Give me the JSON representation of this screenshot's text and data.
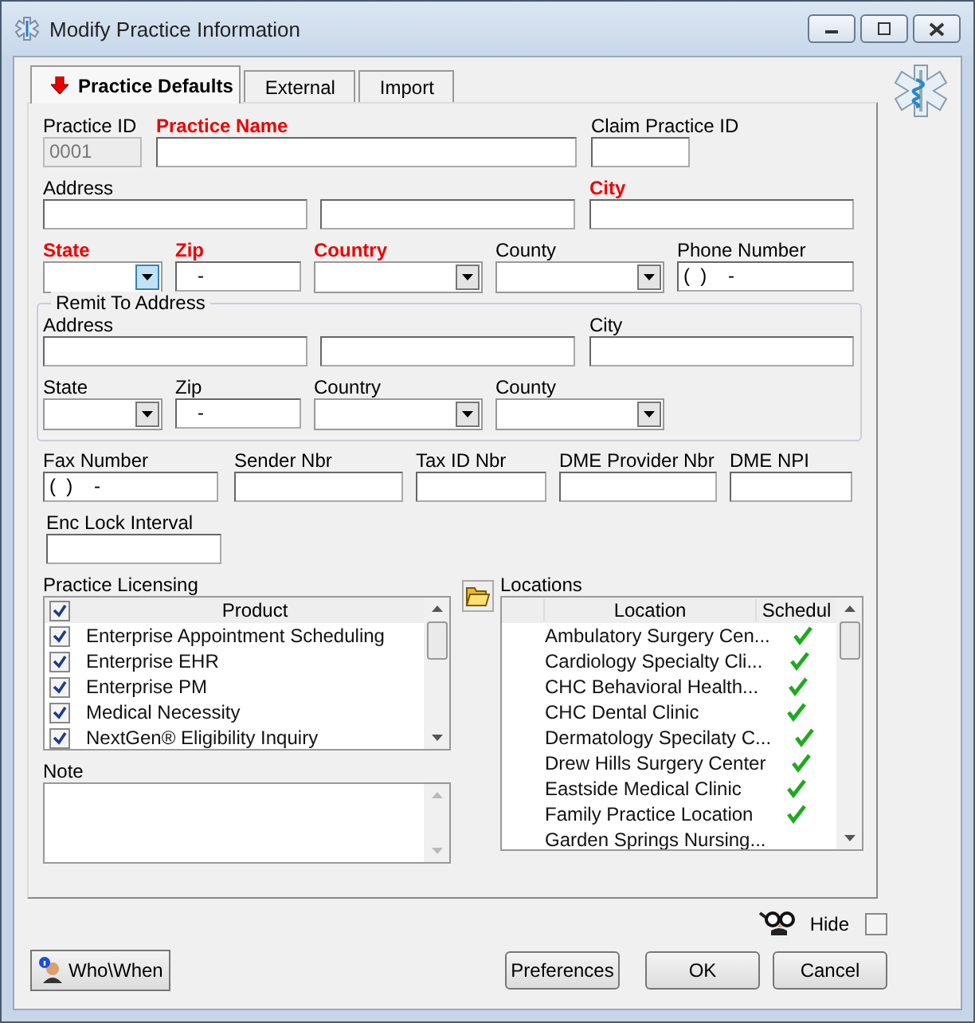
{
  "window": {
    "title": "Modify Practice Information"
  },
  "tabs": [
    {
      "label": "Practice Defaults",
      "selected": true,
      "icon": true
    },
    {
      "label": "External",
      "selected": false,
      "icon": false
    },
    {
      "label": "Import",
      "selected": false,
      "icon": false
    }
  ],
  "fields": [
    [
      {
        "label": "Practice ID",
        "kind": "text",
        "value": "0001",
        "disabled": true
      },
      {
        "label": "Practice Name",
        "required": true,
        "kind": "text",
        "disabled": false
      },
      {
        "label": "Claim Practice ID",
        "kind": "text",
        "disabled": false
      }
    ],
    [
      {
        "label": "Address",
        "kind": "text",
        "disabled": false
      },
      {
        "kind": "text",
        "disabled": false
      },
      {
        "label": "City",
        "required": true,
        "kind": "text",
        "disabled": false
      }
    ],
    [
      {
        "label": "State",
        "required": true,
        "kind": "combo",
        "disabled": false
      },
      {
        "label": "Zip",
        "required": true,
        "kind": "text",
        "value": "   -",
        "disabled": false
      },
      {
        "label": "Country",
        "required": true,
        "kind": "combo",
        "disabled": false
      },
      {
        "label": "County",
        "kind": "combo",
        "disabled": false
      },
      {
        "label": "Phone Number",
        "kind": "text",
        "value": "(  )    -",
        "disabled": false
      }
    ]
  ],
  "remit": {
    "title": "Remit To Address",
    "fields": [
      [
        {
          "label": "Address",
          "kind": "text",
          "disabled": false
        },
        {
          "kind": "text",
          "disabled": false
        },
        {
          "label": "City",
          "kind": "text",
          "disabled": false
        }
      ],
      [
        {
          "label": "State",
          "kind": "combo",
          "disabled": false
        },
        {
          "label": "Zip",
          "kind": "text",
          "value": "   -",
          "disabled": false
        },
        {
          "label": "Country",
          "kind": "combo",
          "disabled": false
        },
        {
          "label": "County",
          "kind": "combo",
          "disabled": false
        }
      ]
    ]
  },
  "more_fields": [
    [
      {
        "label": "Fax Number",
        "kind": "text",
        "value": "(  )    -",
        "disabled": false
      },
      {
        "label": "Sender Nbr",
        "kind": "text",
        "disabled": false
      },
      {
        "label": "Tax ID Nbr",
        "kind": "text",
        "disabled": false
      },
      {
        "label": "DME Provider Nbr",
        "kind": "text",
        "disabled": false
      },
      {
        "label": "DME NPI",
        "kind": "text",
        "disabled": false
      }
    ],
    [
      {
        "label": "Enc Lock Interval",
        "kind": "text",
        "disabled": false
      }
    ]
  ],
  "licensing": {
    "title": "Practice Licensing",
    "header": "Product",
    "header_checked": true,
    "rows": [
      {
        "name": "Enterprise Appointment Scheduling",
        "checked": true
      },
      {
        "name": "Enterprise EHR",
        "checked": true
      },
      {
        "name": "Enterprise PM",
        "checked": true
      },
      {
        "name": "Medical Necessity",
        "checked": true
      },
      {
        "name": "NextGen® Eligibility Inquiry",
        "checked": true
      }
    ]
  },
  "note": {
    "label": "Note"
  },
  "locations": {
    "title": "Locations",
    "columns": [
      "Location",
      "Schedul"
    ],
    "rows": [
      {
        "name": "Ambulatory Surgery Cen...",
        "scheduled": true
      },
      {
        "name": "Cardiology Specialty Cli...",
        "scheduled": true
      },
      {
        "name": "CHC Behavioral Health...",
        "scheduled": true
      },
      {
        "name": "CHC Dental Clinic",
        "scheduled": true
      },
      {
        "name": "Dermatology Specilaty C...",
        "scheduled": true
      },
      {
        "name": "Drew Hills Surgery Center",
        "scheduled": true
      },
      {
        "name": "Eastside Medical Clinic",
        "scheduled": true
      },
      {
        "name": "Family Practice Location",
        "scheduled": true
      },
      {
        "name": "Garden Springs Nursing...",
        "scheduled": false
      }
    ]
  },
  "hide": {
    "label": "Hide",
    "checked": false
  },
  "buttons": {
    "left": "Who\\When",
    "right": [
      "Preferences",
      "OK",
      "Cancel"
    ]
  }
}
